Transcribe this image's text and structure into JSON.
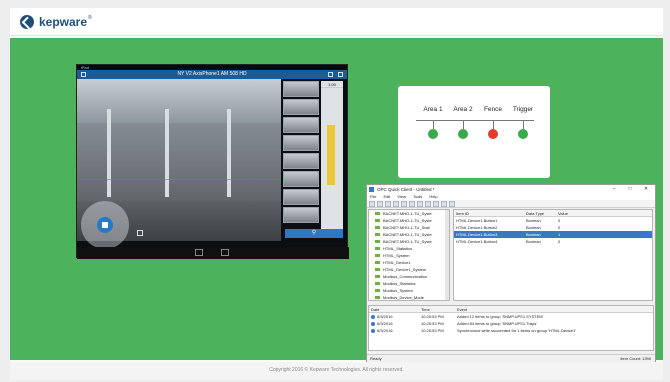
{
  "brand": {
    "name": "kepware",
    "tm": "®"
  },
  "footer": {
    "copyright": "Copyright 2016 © Kepware Technologies. All rights reserved."
  },
  "tablet": {
    "status_bar": "iPad",
    "title": "NY V2 AxisPhone1 AM 508 HD",
    "search_icon": "magnifier-icon",
    "timeline_label": "1.00"
  },
  "status_card": {
    "areas": [
      {
        "label": "Area 1",
        "color": "#3aa84b"
      },
      {
        "label": "Area 2",
        "color": "#3aa84b"
      },
      {
        "label": "Fence",
        "color": "#e53b2c"
      },
      {
        "label": "Trigger",
        "color": "#3aa84b"
      }
    ]
  },
  "quick_client": {
    "title": "OPC Quick Client - Untitled *",
    "window_buttons": [
      "–",
      "□",
      "✕"
    ],
    "menu": [
      "File",
      "Edit",
      "View",
      "Tools",
      "Help"
    ],
    "tree": [
      "BACNET.MHO-1-TU_Syste",
      "BACNET.MHO-1-TU_Syste",
      "BACNET.MHO-1-TU_Stati",
      "BACNET.MHO-1-TU_Syste",
      "BACNET.MHO-1-TU_Syste",
      "HTML_Statistics",
      "HTML_System",
      "HTML_Device1",
      "HTML_Device1_System",
      "Modbus_Communication",
      "Modbus_Statistics",
      "Modbus_System",
      "Modbus_Device_Mode"
    ],
    "grid_head": [
      "Item ID",
      "Data Type",
      "Value"
    ],
    "grid_rows": [
      {
        "id": "HTML.Device1.Button1",
        "type": "Boolean",
        "value": "0",
        "selected": false
      },
      {
        "id": "HTML.Device1.Button2",
        "type": "Boolean",
        "value": "0",
        "selected": false
      },
      {
        "id": "HTML.Device1.Button3",
        "type": "Boolean",
        "value": "1",
        "selected": true
      },
      {
        "id": "HTML.Device1.Button4",
        "type": "Boolean",
        "value": "0",
        "selected": false
      }
    ],
    "log_head": [
      "Date",
      "Time",
      "Event"
    ],
    "log_rows": [
      {
        "date": "6/3/2016",
        "time": "10:25:53 PM",
        "event": "Added 12 items to group 'SNMP.UPS1.SYSTEM'"
      },
      {
        "date": "6/3/2016",
        "time": "10:25:53 PM",
        "event": "Added 84 items to group 'SNMP.UPS1.Traps'"
      },
      {
        "date": "6/3/2016",
        "time": "10:25:53 PM",
        "event": "Synchronous write succeeded for 1 items on group 'HTML.Device1'"
      }
    ],
    "status_left": "Ready",
    "status_right": "Item Count: 1390"
  }
}
